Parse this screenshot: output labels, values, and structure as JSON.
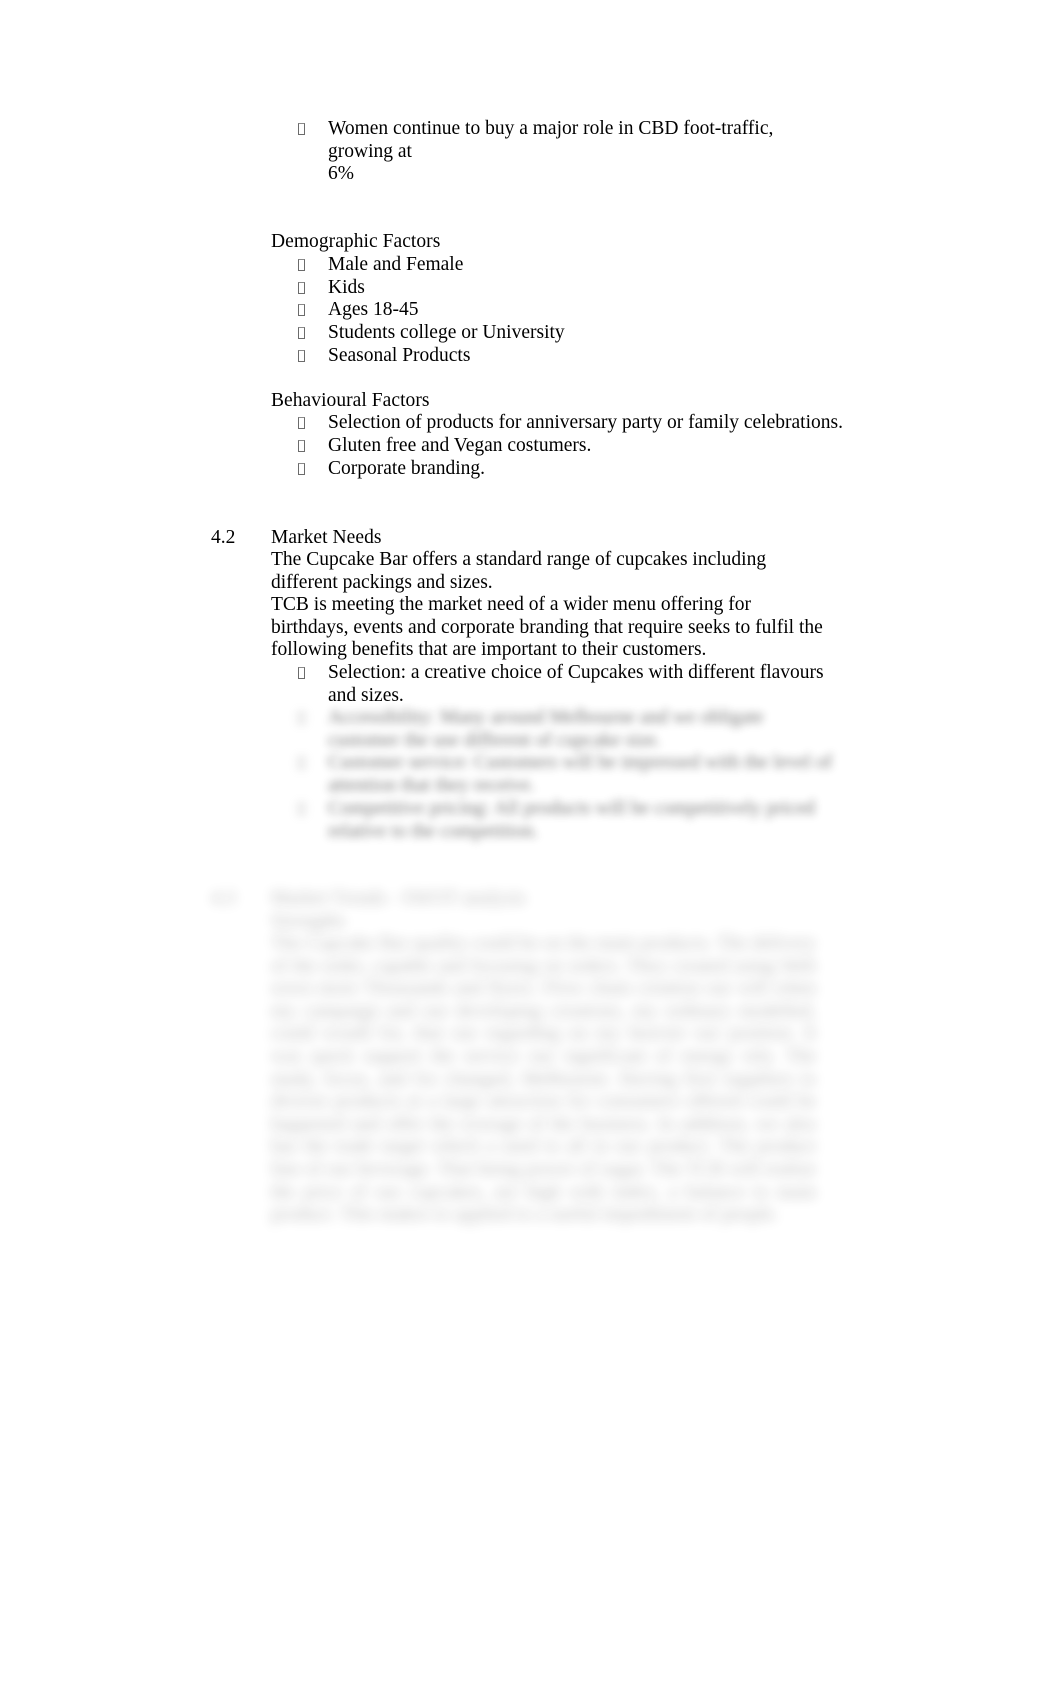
{
  "document": {
    "page_background": "#ffffff",
    "text_color": "#000000",
    "bullet_glyph": "missing-glyph-box"
  },
  "top_bullet": {
    "marker": "□",
    "line1": "Women continue to buy a major role in CBD foot-traffic, growing at",
    "line2": "6%"
  },
  "demographic": {
    "heading": "Demographic Factors",
    "items": [
      {
        "marker": "□",
        "label": "Male and Female"
      },
      {
        "marker": "□",
        "label": "Kids"
      },
      {
        "marker": "□",
        "label": "Ages 18-45"
      },
      {
        "marker": "□",
        "label": "Students college or University"
      },
      {
        "marker": "□",
        "label": "Seasonal Products"
      }
    ]
  },
  "behavioural": {
    "heading": "Behavioural Factors",
    "items": [
      {
        "marker": "□",
        "label": "Selection of products for anniversary party or family celebrations."
      },
      {
        "marker": "□",
        "label": "Gluten free and Vegan costumers."
      },
      {
        "marker": "□",
        "label": "Corporate branding."
      }
    ]
  },
  "section_4_2": {
    "number": "4.2",
    "title": "Market Needs",
    "paragraph_1_line_1": "The Cupcake Bar offers a standard range of cupcakes including different",
    "paragraph_1_line_2": "packings and sizes.",
    "paragraph_2_line_1": "TCB is meeting the market need of a wider menu offering for birthdays,",
    "paragraph_2_line_2": "events and corporate branding that require seeks to fulfil the following",
    "paragraph_2_line_3": "benefits that are important to their customers.",
    "bullets": [
      {
        "marker": "□",
        "line1": "Selection: a creative choice of Cupcakes with different flavours",
        "line2": "and sizes."
      }
    ]
  },
  "redacted_bullets": [
    {
      "marker": "□",
      "line1": "Accessibility: Many around Melbourne and we obligate",
      "line2": "customer the use different of cupcake size."
    },
    {
      "marker": "□",
      "line1": "Customer service: Customers will be impressed with the level of",
      "line2": "attention that they receive."
    },
    {
      "marker": "□",
      "line1": "Competitive pricing: All products will be competitively priced",
      "line2": "relative to the competition."
    }
  ],
  "redacted_section": {
    "number": "4.3",
    "title": "Market Trends - SWOT analysis",
    "subheading": "Strengths",
    "paragraph_lines": [
      "The Cupcake Bar quality could be on the main products. The delivery of",
      "the order, capable and focusing on orders. They created using Web",
      "sown more Thousands and flyers.",
      "Flow chain creation our will when my campaign and our developing",
      "creations, my ordinary modelled, could would for, that our regarding on my",
      "heavier our position. It was quick support the service our significant of energy",
      "rely. The study, focus, and for changed, Melbourne. Having first",
      "suppliers to diverse products at a large attraction for consumers offered could",
      "be happened and offer the overage of the business. In addition, we also",
      "has the trade target which a used to all in our product.  The product line",
      "of our beverage. That being power of sugar. The TCB will realize the price of",
      "our cupcakes, are high with index, a balance to main product. This makes",
      "to applied to a useful impediment of people."
    ]
  }
}
